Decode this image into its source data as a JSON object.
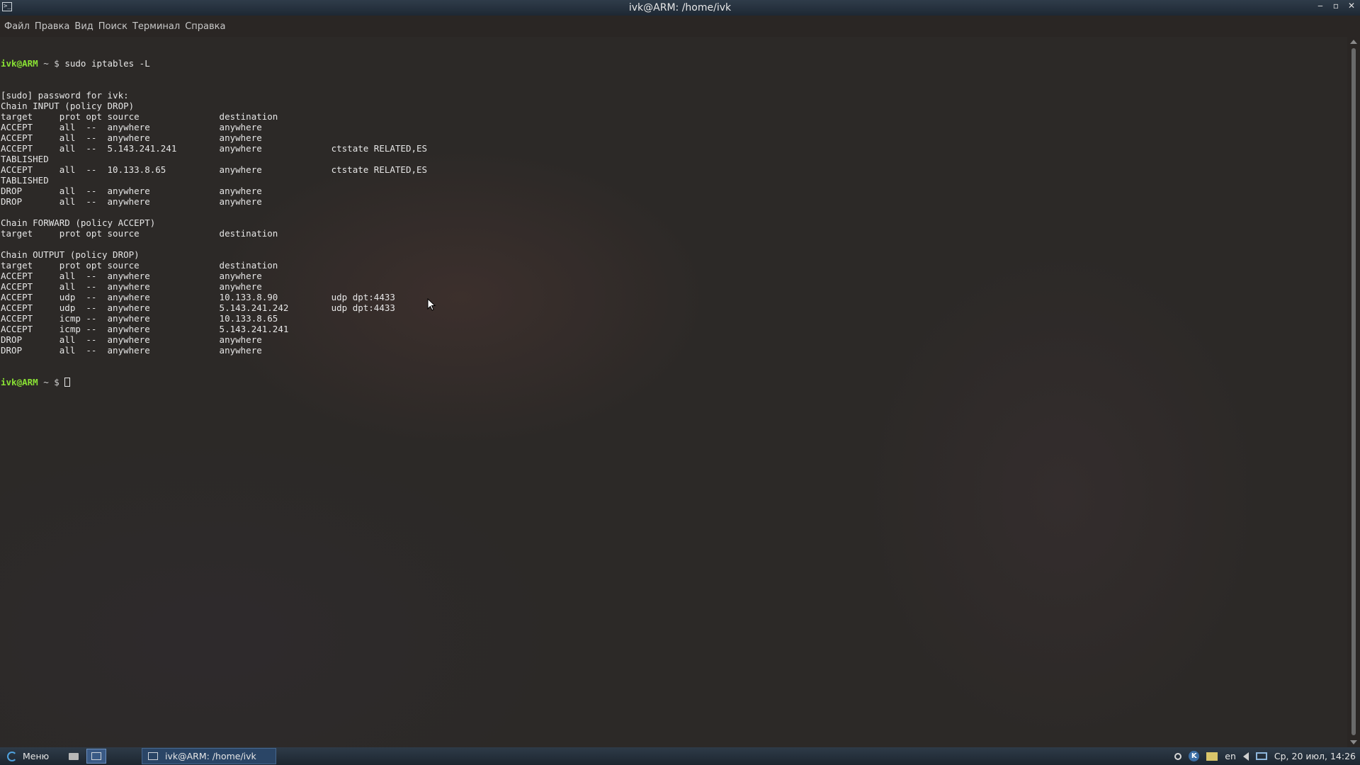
{
  "window": {
    "title": "ivk@ARM: /home/ivk",
    "controls": {
      "minimize": "‒",
      "maximize": "▫",
      "close": "✕"
    },
    "app_icon": ">_"
  },
  "menubar": {
    "items": [
      "Файл",
      "Правка",
      "Вид",
      "Поиск",
      "Терминал",
      "Справка"
    ]
  },
  "terminal": {
    "prompt_user": "ivk@ARM",
    "prompt_path": " ~ $ ",
    "command": "sudo iptables -L",
    "output": [
      "[sudo] password for ivk:",
      "Chain INPUT (policy DROP)",
      "target     prot opt source               destination",
      "ACCEPT     all  --  anywhere             anywhere",
      "ACCEPT     all  --  anywhere             anywhere",
      "ACCEPT     all  --  5.143.241.241        anywhere             ctstate RELATED,ES",
      "TABLISHED",
      "ACCEPT     all  --  10.133.8.65          anywhere             ctstate RELATED,ES",
      "TABLISHED",
      "DROP       all  --  anywhere             anywhere",
      "DROP       all  --  anywhere             anywhere",
      "",
      "Chain FORWARD (policy ACCEPT)",
      "target     prot opt source               destination",
      "",
      "Chain OUTPUT (policy DROP)",
      "target     prot opt source               destination",
      "ACCEPT     all  --  anywhere             anywhere",
      "ACCEPT     all  --  anywhere             anywhere",
      "ACCEPT     udp  --  anywhere             10.133.8.90          udp dpt:4433",
      "ACCEPT     udp  --  anywhere             5.143.241.242        udp dpt:4433",
      "ACCEPT     icmp --  anywhere             10.133.8.65",
      "ACCEPT     icmp --  anywhere             5.143.241.241",
      "DROP       all  --  anywhere             anywhere",
      "DROP       all  --  anywhere             anywhere"
    ]
  },
  "taskbar": {
    "menu_label": "Меню",
    "task_label": "ivk@ARM: /home/ivk",
    "tray": {
      "language": "en",
      "clock": "Ср, 20 июл, 14:26"
    }
  },
  "colors": {
    "prompt": "#8ae234",
    "terminal_text": "#e6e6e6",
    "titlebar": "#2f3c4a",
    "taskbar_active": "#2a4566"
  }
}
